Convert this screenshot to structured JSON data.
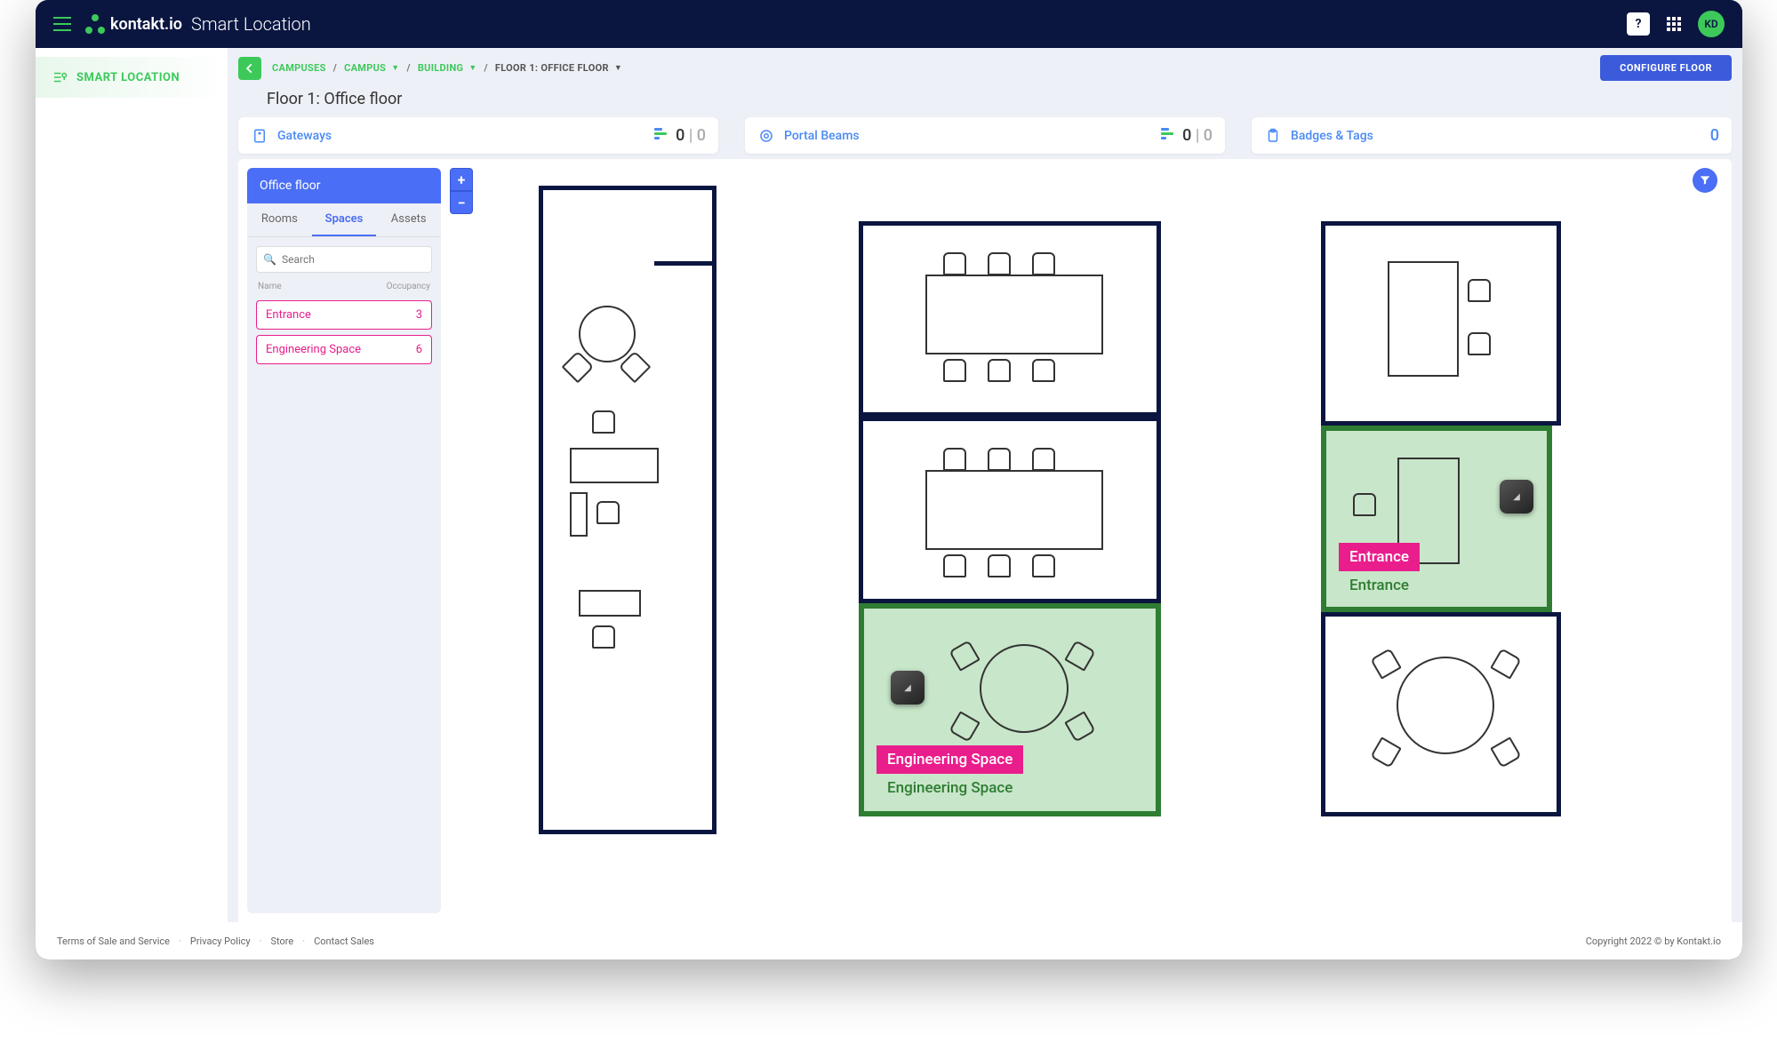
{
  "app": {
    "brand": "kontakt.io",
    "title": "Smart Location",
    "avatar": "KD"
  },
  "sidebar": {
    "smart_location": "SMART LOCATION"
  },
  "breadcrumbs": {
    "campuses": "CAMPUSES",
    "campus": "CAMPUS",
    "building": "BUILDING",
    "floor": "FLOOR 1: OFFICE FLOOR"
  },
  "buttons": {
    "configure_floor": "CONFIGURE FLOOR"
  },
  "page": {
    "title": "Floor 1: Office floor"
  },
  "stats": {
    "gateways": {
      "label": "Gateways",
      "active": "0",
      "total": "0"
    },
    "portal_beams": {
      "label": "Portal Beams",
      "active": "0",
      "total": "0"
    },
    "badges": {
      "label": "Badges & Tags",
      "count": "0"
    }
  },
  "panel": {
    "header": "Office floor",
    "tabs": {
      "rooms": "Rooms",
      "spaces": "Spaces",
      "assets": "Assets"
    },
    "search_placeholder": "Search",
    "columns": {
      "name": "Name",
      "occupancy": "Occupancy"
    },
    "items": [
      {
        "name": "Entrance",
        "count": "3"
      },
      {
        "name": "Engineering Space",
        "count": "6"
      }
    ]
  },
  "map": {
    "engineering_tag": "Engineering Space",
    "engineering_sub": "Engineering Space",
    "entrance_tag": "Entrance",
    "entrance_sub": "Entrance"
  },
  "zoom": {
    "in": "+",
    "out": "−"
  },
  "footer": {
    "links": [
      "Terms of Sale and Service",
      "Privacy Policy",
      "Store",
      "Contact Sales"
    ],
    "copyright": "Copyright 2022 © by Kontakt.io"
  }
}
